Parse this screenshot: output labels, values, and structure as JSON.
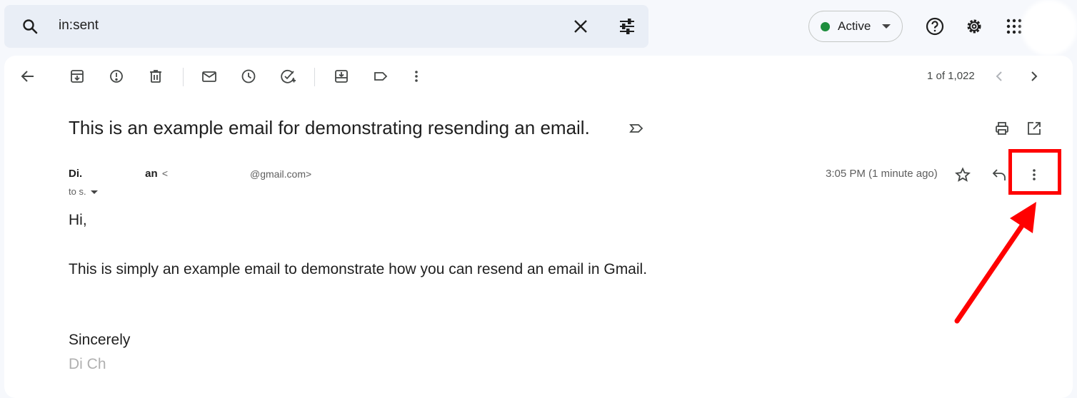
{
  "search": {
    "query": "in:sent"
  },
  "status": {
    "label": "Active",
    "color": "#1e8e3e"
  },
  "toolbar": {
    "pagination": "1 of 1,022"
  },
  "email": {
    "subject": "This is an example email for demonstrating resending an email.",
    "sender_name_start": "Di.",
    "sender_name_end": "an",
    "sender_address_start": "<",
    "sender_address_end": "@gmail.com>",
    "to": "to s.",
    "time": "3:05 PM (1 minute ago)",
    "greeting": "Hi,",
    "body": "This is simply an example email to demonstrate how you can resend an email in Gmail.",
    "closing": "Sincerely",
    "signature": "Di       Ch"
  },
  "annotation": {
    "color": "#ff0000"
  }
}
